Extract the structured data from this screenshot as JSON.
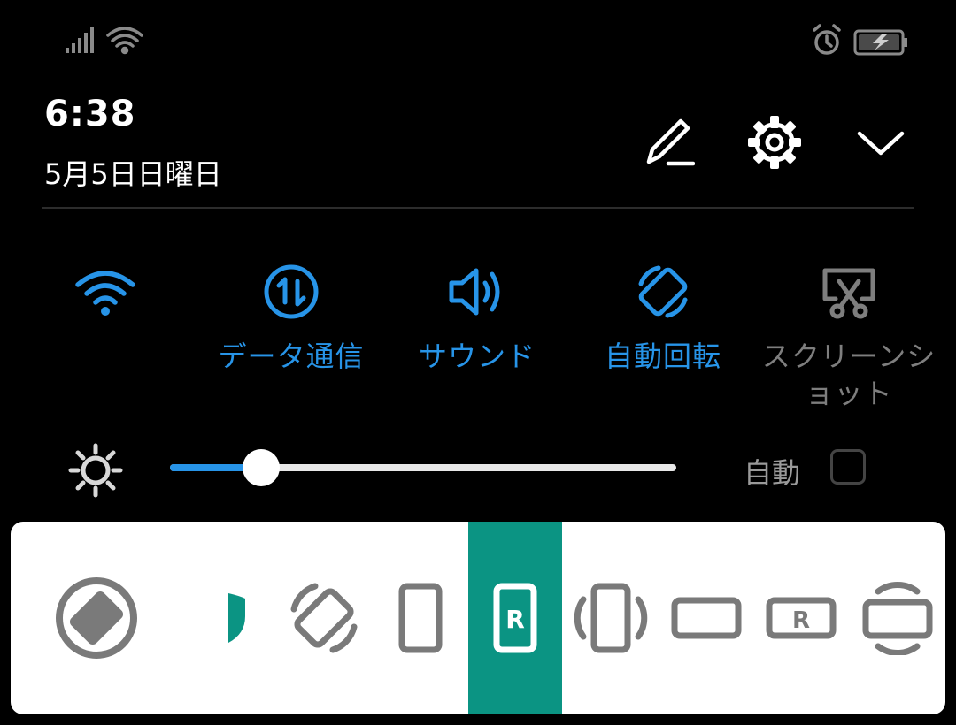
{
  "status_bar": {
    "left_icons": [
      "signal-icon",
      "wifi-icon"
    ],
    "right_icons": [
      "alarm-icon",
      "battery-charging-icon"
    ]
  },
  "header": {
    "time": "6:38",
    "date": "5月5日日曜日",
    "actions": [
      "edit-icon",
      "settings-icon",
      "chevron-down-icon"
    ]
  },
  "tiles": [
    {
      "label": "",
      "icon": "wifi-icon",
      "active": true
    },
    {
      "label": "データ通信",
      "icon": "data-transfer-icon",
      "active": true
    },
    {
      "label": "サウンド",
      "icon": "sound-icon",
      "active": true
    },
    {
      "label": "自動回転",
      "icon": "auto-rotate-icon",
      "active": true
    },
    {
      "label": "スクリーンショット",
      "icon": "screenshot-icon",
      "active": false
    }
  ],
  "brightness": {
    "level": 0.18,
    "auto_label": "自動",
    "auto_checked": false
  },
  "rotation_options": [
    {
      "icon": "auto-rotate-circle-icon",
      "selected": false
    },
    {
      "icon": "shield-icon",
      "selected": true
    },
    {
      "icon": "rotate-icon",
      "selected": false
    },
    {
      "icon": "portrait-icon",
      "selected": false
    },
    {
      "icon": "portrait-r-icon",
      "selected": true,
      "letter": "R"
    },
    {
      "icon": "portrait-rotate-icon",
      "selected": false
    },
    {
      "icon": "landscape-icon",
      "selected": false
    },
    {
      "icon": "landscape-r-icon",
      "selected": false,
      "letter": "R"
    },
    {
      "icon": "landscape-rotate-icon",
      "selected": false
    }
  ],
  "colors": {
    "accent": "#2794e8",
    "selected_bg": "#0b9483",
    "icon_gray": "#7a7a7a",
    "background": "#000000"
  }
}
